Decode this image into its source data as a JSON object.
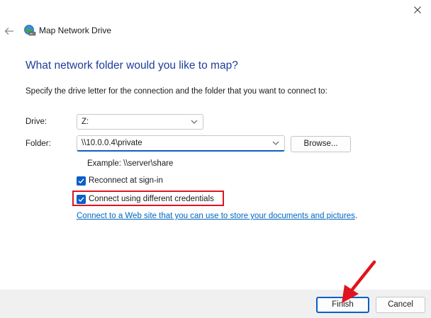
{
  "window": {
    "title": "Map Network Drive"
  },
  "heading": "What network folder would you like to map?",
  "instruction": "Specify the drive letter for the connection and the folder that you want to connect to:",
  "drive": {
    "label": "Drive:",
    "value": "Z:"
  },
  "folder": {
    "label": "Folder:",
    "value": "\\\\10.0.0.4\\private"
  },
  "browse_label": "Browse...",
  "example": "Example: \\\\server\\share",
  "reconnect": {
    "label": "Reconnect at sign-in",
    "checked": true
  },
  "credentials": {
    "label": "Connect using different credentials",
    "checked": true
  },
  "web_link": "Connect to a Web site that you can use to store your documents and pictures",
  "web_link_suffix": ".",
  "footer": {
    "finish_label": "Finish",
    "cancel_label": "Cancel"
  },
  "colors": {
    "accent": "#0a5fc7",
    "heading": "#1c3e9c",
    "link": "#0067c0",
    "annotation": "#e0141e"
  },
  "icons": [
    "close-icon",
    "back-arrow-icon",
    "network-drive-icon",
    "chevron-down-icon",
    "checkmark-icon",
    "arrow-annotation-icon"
  ]
}
